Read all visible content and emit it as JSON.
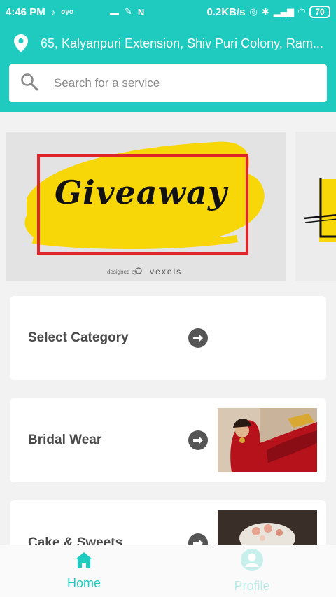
{
  "status_bar": {
    "time": "4:46 PM",
    "left_icons": [
      "tiktok-icon",
      "oyo-icon"
    ],
    "middle_icons": [
      "card-icon",
      "pin-tool-icon",
      "n-app-icon"
    ],
    "speed": "0.2KB/s",
    "battery": "70"
  },
  "header": {
    "address": "65, Kalyanpuri Extension, Shiv Puri Colony, Ram...",
    "search_placeholder": "Search for a service"
  },
  "banner": {
    "title": "Giveaway",
    "credit_prefix": "designed by",
    "credit_brand": "vexels"
  },
  "categories": [
    {
      "label": "Select Category"
    },
    {
      "label": "Bridal Wear"
    },
    {
      "label": "Cake & Sweets"
    }
  ],
  "bottom_nav": {
    "home": "Home",
    "profile": "Profile"
  },
  "colors": {
    "brand": "#1ecbbe",
    "banner_yellow": "#f7d708",
    "frame_red": "#e0242b"
  }
}
